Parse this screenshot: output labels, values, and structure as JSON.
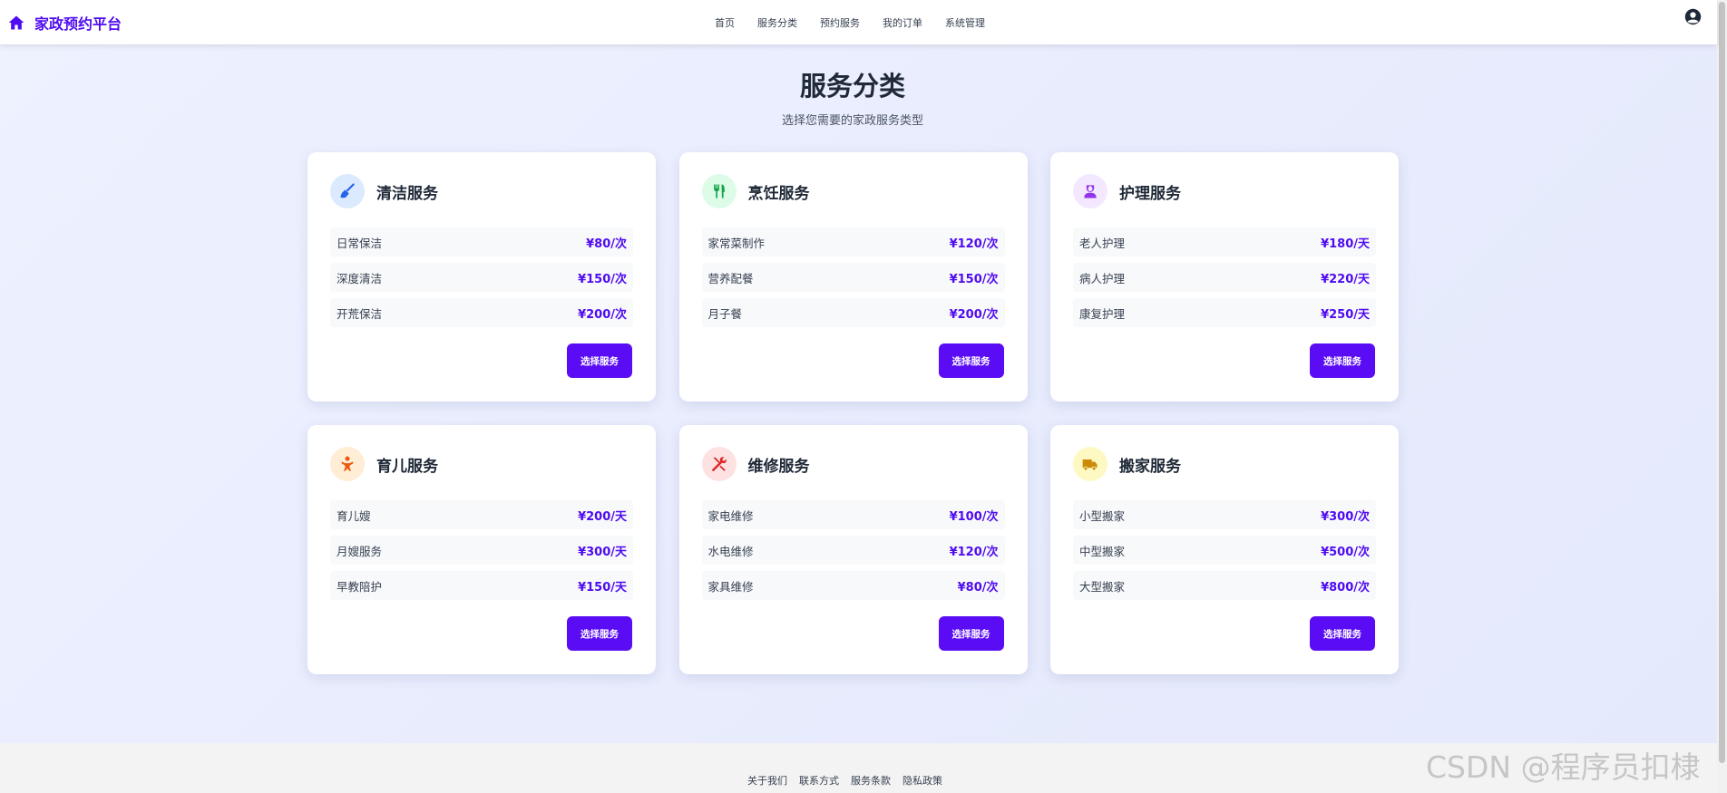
{
  "app": {
    "brand": "家政预约平台",
    "nav": [
      "首页",
      "服务分类",
      "预约服务",
      "我的订单",
      "系统管理"
    ]
  },
  "header": {
    "title": "服务分类",
    "subtitle": "选择您需要的家政服务类型"
  },
  "cards": [
    {
      "title": "清洁服务",
      "icon": "broom-icon",
      "icon_bg": "#dbeafe",
      "icon_color": "#2563eb",
      "items": [
        {
          "name": "日常保洁",
          "price": "¥80/次"
        },
        {
          "name": "深度清洁",
          "price": "¥150/次"
        },
        {
          "name": "开荒保洁",
          "price": "¥200/次"
        }
      ],
      "button": "选择服务"
    },
    {
      "title": "烹饪服务",
      "icon": "utensils-icon",
      "icon_bg": "#dcfce7",
      "icon_color": "#16a34a",
      "items": [
        {
          "name": "家常菜制作",
          "price": "¥120/次"
        },
        {
          "name": "营养配餐",
          "price": "¥150/次"
        },
        {
          "name": "月子餐",
          "price": "¥200/次"
        }
      ],
      "button": "选择服务"
    },
    {
      "title": "护理服务",
      "icon": "nurse-icon",
      "icon_bg": "#f3e8ff",
      "icon_color": "#9333ea",
      "items": [
        {
          "name": "老人护理",
          "price": "¥180/天"
        },
        {
          "name": "病人护理",
          "price": "¥220/天"
        },
        {
          "name": "康复护理",
          "price": "¥250/天"
        }
      ],
      "button": "选择服务"
    },
    {
      "title": "育儿服务",
      "icon": "child-icon",
      "icon_bg": "#ffedd5",
      "icon_color": "#ea580c",
      "items": [
        {
          "name": "育儿嫂",
          "price": "¥200/天"
        },
        {
          "name": "月嫂服务",
          "price": "¥300/天"
        },
        {
          "name": "早教陪护",
          "price": "¥150/天"
        }
      ],
      "button": "选择服务"
    },
    {
      "title": "维修服务",
      "icon": "tools-icon",
      "icon_bg": "#fee2e2",
      "icon_color": "#dc2626",
      "items": [
        {
          "name": "家电维修",
          "price": "¥100/次"
        },
        {
          "name": "水电维修",
          "price": "¥120/次"
        },
        {
          "name": "家具维修",
          "price": "¥80/次"
        }
      ],
      "button": "选择服务"
    },
    {
      "title": "搬家服务",
      "icon": "truck-icon",
      "icon_bg": "#fef9c3",
      "icon_color": "#ca8a04",
      "items": [
        {
          "name": "小型搬家",
          "price": "¥300/次"
        },
        {
          "name": "中型搬家",
          "price": "¥500/次"
        },
        {
          "name": "大型搬家",
          "price": "¥800/次"
        }
      ],
      "button": "选择服务"
    }
  ],
  "footer": {
    "links": [
      "关于我们",
      "联系方式",
      "服务条款",
      "隐私政策"
    ]
  },
  "watermark": "CSDN @程序员扣棣"
}
